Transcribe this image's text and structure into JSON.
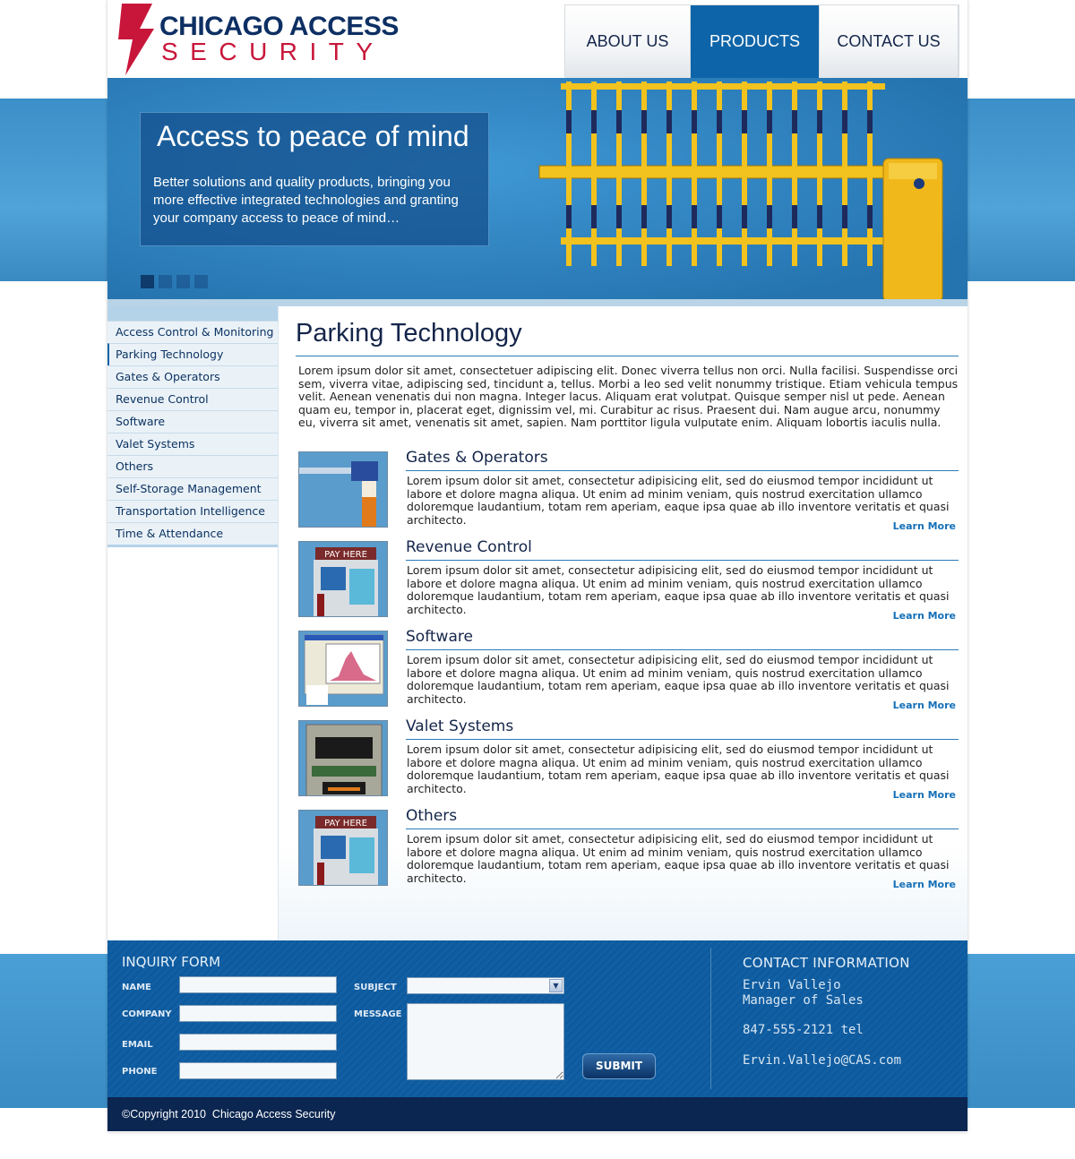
{
  "brand": {
    "line1": "CHICAGO ACCESS",
    "line2": "SECURITY",
    "colors": {
      "navy": "#0d2f63",
      "red": "#c8163a",
      "blue": "#0e64a8"
    }
  },
  "nav": {
    "items": [
      {
        "label": "ABOUT US",
        "active": false
      },
      {
        "label": "PRODUCTS",
        "active": true
      },
      {
        "label": "CONTACT US",
        "active": false
      }
    ]
  },
  "hero": {
    "title": "Access to peace of mind",
    "text": "Better solutions and quality products, bringing you more effective integrated technologies and granting your company access to peace of mind…",
    "slides": 4,
    "active_slide": 1
  },
  "sidebar": {
    "items": [
      {
        "label": "Access Control & Monitoring"
      },
      {
        "label": "Parking Technology",
        "active": true
      },
      {
        "label": "Gates & Operators"
      },
      {
        "label": "Revenue Control"
      },
      {
        "label": "Software"
      },
      {
        "label": "Valet Systems"
      },
      {
        "label": "Others"
      },
      {
        "label": "Self-Storage Management"
      },
      {
        "label": "Transportation Intelligence"
      },
      {
        "label": "Time & Attendance"
      }
    ]
  },
  "main": {
    "title": "Parking Technology",
    "intro": "Lorem ipsum dolor sit amet, consectetuer adipiscing elit. Donec viverra tellus non orci. Nulla facilisi. Suspendisse orci sem, viverra vitae, adipiscing sed, tincidunt a, tellus. Morbi a leo sed velit nonummy tristique. Etiam vehicula tempus velit. Aenean venenatis dui non magna. Integer lacus. Aliquam erat volutpat. Quisque semper nisl ut pede. Aenean quam eu, tempor in, placerat eget, dignissim vel, mi. Curabitur ac risus. Praesent dui. Nam augue arcu, nonummy eu, viverra sit amet, venenatis sit amet, sapien. Nam porttitor ligula vulputate enim. Aliquam lobortis iaculis nulla.",
    "products": [
      {
        "title": "Gates & Operators",
        "icon": "gate-arm-image",
        "text": "Lorem ipsum dolor sit amet, consectetur adipisicing elit, sed do eiusmod tempor incididunt ut labore et dolore magna aliqua. Ut enim ad minim veniam, quis nostrud exercitation ullamco doloremque laudantium, totam rem aperiam, eaque ipsa quae ab illo inventore veritatis et quasi architecto.",
        "link": "Learn More"
      },
      {
        "title": "Revenue Control",
        "icon": "pay-station-image",
        "text": "Lorem ipsum dolor sit amet, consectetur adipisicing elit, sed do eiusmod tempor incididunt ut labore et dolore magna aliqua. Ut enim ad minim veniam, quis nostrud exercitation ullamco doloremque laudantium, totam rem aperiam, eaque ipsa quae ab illo inventore veritatis et quasi architecto.",
        "link": "Learn More"
      },
      {
        "title": "Software",
        "icon": "software-screenshot-image",
        "text": "Lorem ipsum dolor sit amet, consectetur adipisicing elit, sed do eiusmod tempor incididunt ut labore et dolore magna aliqua. Ut enim ad minim veniam, quis nostrud exercitation ullamco doloremque laudantium, totam rem aperiam, eaque ipsa quae ab illo inventore veritatis et quasi architecto.",
        "link": "Learn More"
      },
      {
        "title": "Valet Systems",
        "icon": "valet-kiosk-image",
        "text": "Lorem ipsum dolor sit amet, consectetur adipisicing elit, sed do eiusmod tempor incididunt ut labore et dolore magna aliqua. Ut enim ad minim veniam, quis nostrud exercitation ullamco doloremque laudantium, totam rem aperiam, eaque ipsa quae ab illo inventore veritatis et quasi architecto.",
        "link": "Learn More"
      },
      {
        "title": "Others",
        "icon": "pay-station-image",
        "text": "Lorem ipsum dolor sit amet, consectetur adipisicing elit, sed do eiusmod tempor incididunt ut labore et dolore magna aliqua. Ut enim ad minim veniam, quis nostrud exercitation ullamco doloremque laudantium, totam rem aperiam, eaque ipsa quae ab illo inventore veritatis et quasi architecto.",
        "link": "Learn More"
      }
    ],
    "thumb_label": "PAY HERE"
  },
  "inquiry": {
    "title": "INQUIRY FORM",
    "name_label": "NAME",
    "company_label": "COMPANY",
    "email_label": "EMAIL",
    "phone_label": "PHONE",
    "subject_label": "SUBJECT",
    "message_label": "MESSAGE",
    "name_value": "",
    "company_value": "",
    "email_value": "",
    "phone_value": "",
    "subject_value": "",
    "message_value": "",
    "submit_label": "SUBMIT"
  },
  "contact": {
    "title": "CONTACT INFORMATION",
    "name": "Ervin Vallejo",
    "role": "Manager of Sales",
    "phone": "847-555-2121 tel",
    "email": "Ervin.Vallejo@CAS.com"
  },
  "footer": {
    "copyright": "©Copyright 2010  Chicago Access Security"
  }
}
